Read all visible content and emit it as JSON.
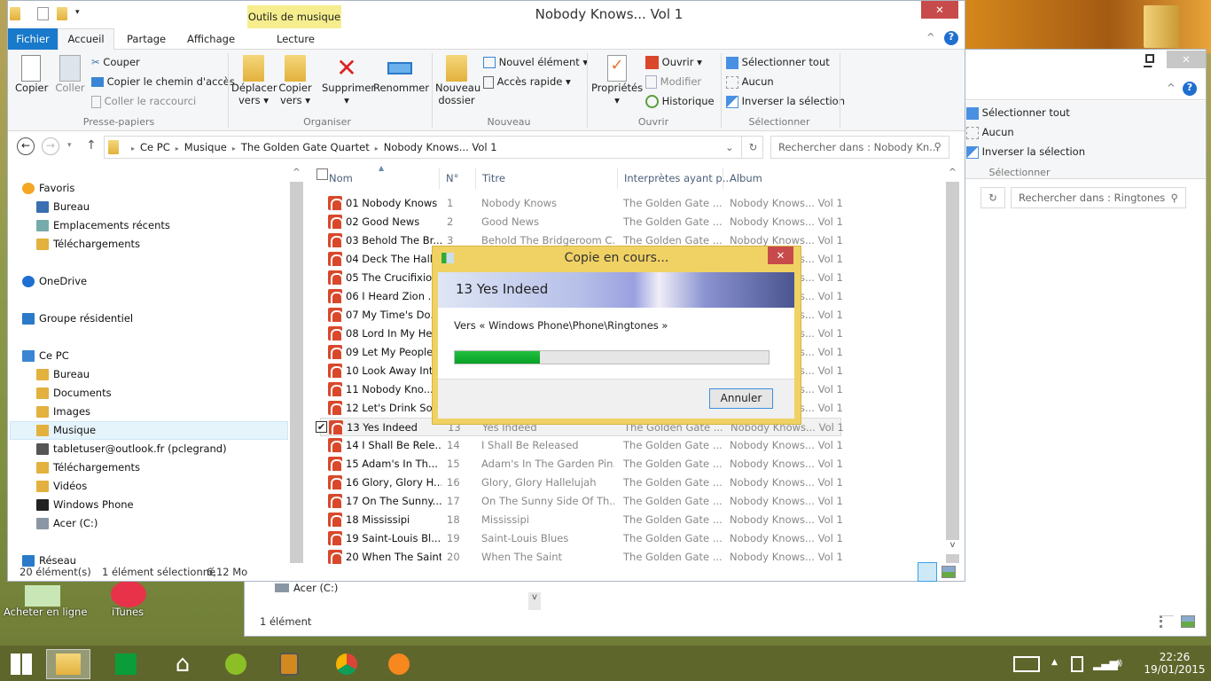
{
  "desktop": {
    "icons": [
      {
        "label": "Acheter en ligne"
      },
      {
        "label": "iTunes"
      }
    ]
  },
  "explorer": {
    "title": "Nobody Knows... Vol 1",
    "context_tab": "Outils de musique",
    "tabs": [
      "Fichier",
      "Accueil",
      "Partage",
      "Affichage",
      "Lecture"
    ],
    "ribbon": {
      "presse_papiers": {
        "label": "Presse-papiers",
        "copier": "Copier",
        "coller": "Coller",
        "couper": "Couper",
        "copier_chemin": "Copier le chemin d'accès",
        "coller_raccourci": "Coller le raccourci"
      },
      "organiser": {
        "label": "Organiser",
        "deplacer": "Déplacer",
        "vers": "vers",
        "copier": "Copier",
        "supprimer": "Supprimer",
        "renommer": "Renommer"
      },
      "nouveau": {
        "label": "Nouveau",
        "dossier1": "Nouveau",
        "dossier2": "dossier",
        "element": "Nouvel élément",
        "acces": "Accès rapide"
      },
      "ouvrir": {
        "label": "Ouvrir",
        "proprietes": "Propriétés",
        "ouvrir": "Ouvrir",
        "modifier": "Modifier",
        "historique": "Historique"
      },
      "selectionner": {
        "label": "Sélectionner",
        "tout": "Sélectionner tout",
        "aucun": "Aucun",
        "inverser": "Inverser la sélection"
      }
    },
    "breadcrumb": [
      "Ce PC",
      "Musique",
      "The Golden Gate Quartet",
      "Nobody Knows... Vol 1"
    ],
    "search_placeholder": "Rechercher dans : Nobody Kn...",
    "nav": [
      {
        "label": "Favoris",
        "icon": "star-icon",
        "level": 0
      },
      {
        "label": "Bureau",
        "icon": "desktop-icon",
        "level": 1
      },
      {
        "label": "Emplacements récents",
        "icon": "recent-icon",
        "level": 1
      },
      {
        "label": "Téléchargements",
        "icon": "downloads-folder-icon",
        "level": 1
      },
      {
        "label": "OneDrive",
        "icon": "onedrive-icon",
        "level": 0
      },
      {
        "label": "Groupe résidentiel",
        "icon": "homegroup-icon",
        "level": 0
      },
      {
        "label": "Ce PC",
        "icon": "computer-icon",
        "level": 0
      },
      {
        "label": "Bureau",
        "icon": "folder-icon",
        "level": 1
      },
      {
        "label": "Documents",
        "icon": "folder-icon",
        "level": 1
      },
      {
        "label": "Images",
        "icon": "folder-icon",
        "level": 1
      },
      {
        "label": "Musique",
        "icon": "folder-icon",
        "level": 1,
        "selected": true
      },
      {
        "label": "tabletuser@outlook.fr (pclegrand)",
        "icon": "user-icon",
        "level": 1
      },
      {
        "label": "Téléchargements",
        "icon": "folder-icon",
        "level": 1
      },
      {
        "label": "Vidéos",
        "icon": "folder-icon",
        "level": 1
      },
      {
        "label": "Windows Phone",
        "icon": "phone-icon",
        "level": 1
      },
      {
        "label": "Acer (C:)",
        "icon": "drive-icon",
        "level": 1
      },
      {
        "label": "Réseau",
        "icon": "network-icon",
        "level": 0
      }
    ],
    "columns": [
      "Nom",
      "N°",
      "Titre",
      "Interprètes ayant p...",
      "Album"
    ],
    "files": [
      {
        "name": "01 Nobody Knows",
        "n": "1",
        "title": "Nobody Knows",
        "artist": "The Golden Gate ...",
        "album": "Nobody Knows... Vol 1"
      },
      {
        "name": "02 Good News",
        "n": "2",
        "title": "Good News",
        "artist": "The Golden Gate ...",
        "album": "Nobody Knows... Vol 1"
      },
      {
        "name": "03 Behold The Br...",
        "n": "3",
        "title": "Behold The Bridgeroom C...",
        "artist": "The Golden Gate ...",
        "album": "Nobody Knows... Vol 1"
      },
      {
        "name": "04 Deck The Halls",
        "n": "",
        "title": "",
        "artist": "",
        "album": "Nobody Knows... Vol 1"
      },
      {
        "name": "05 The Crucifixion",
        "n": "",
        "title": "",
        "artist": "",
        "album": "Nobody Knows... Vol 1"
      },
      {
        "name": "06 I Heard Zion ...",
        "n": "",
        "title": "",
        "artist": "",
        "album": "Nobody Knows... Vol 1"
      },
      {
        "name": "07 My Time's Do...",
        "n": "",
        "title": "",
        "artist": "",
        "album": "Nobody Knows... Vol 1"
      },
      {
        "name": "08 Lord In My He...",
        "n": "",
        "title": "",
        "artist": "",
        "album": "Nobody Knows... Vol 1"
      },
      {
        "name": "09 Let My People",
        "n": "",
        "title": "",
        "artist": "",
        "album": "Nobody Knows... Vol 1"
      },
      {
        "name": "10 Look Away Int...",
        "n": "",
        "title": "",
        "artist": "",
        "album": "Nobody Knows... Vol 1"
      },
      {
        "name": "11 Nobody Kno...",
        "n": "",
        "title": "",
        "artist": "",
        "album": "Nobody Knows... Vol 1"
      },
      {
        "name": "12 Let's Drink So...",
        "n": "",
        "title": "",
        "artist": "",
        "album": "Nobody Knows... Vol 1"
      },
      {
        "name": "13 Yes Indeed",
        "n": "13",
        "title": "Yes Indeed",
        "artist": "The Golden Gate ...",
        "album": "Nobody Knows... Vol 1",
        "selected": true
      },
      {
        "name": "14 I Shall Be Rele...",
        "n": "14",
        "title": "I Shall Be Released",
        "artist": "The Golden Gate ...",
        "album": "Nobody Knows... Vol 1"
      },
      {
        "name": "15 Adam's In Th...",
        "n": "15",
        "title": "Adam's In The Garden Pin...",
        "artist": "The Golden Gate ...",
        "album": "Nobody Knows... Vol 1"
      },
      {
        "name": "16 Glory, Glory H...",
        "n": "16",
        "title": "Glory, Glory Hallelujah",
        "artist": "The Golden Gate ...",
        "album": "Nobody Knows... Vol 1"
      },
      {
        "name": "17 On The Sunny...",
        "n": "17",
        "title": "On The Sunny Side Of Th...",
        "artist": "The Golden Gate ...",
        "album": "Nobody Knows... Vol 1"
      },
      {
        "name": "18 Mississipi",
        "n": "18",
        "title": "Mississipi",
        "artist": "The Golden Gate ...",
        "album": "Nobody Knows... Vol 1"
      },
      {
        "name": "19 Saint-Louis Bl...",
        "n": "19",
        "title": "Saint-Louis Blues",
        "artist": "The Golden Gate ...",
        "album": "Nobody Knows... Vol 1"
      },
      {
        "name": "20 When The Saint",
        "n": "20",
        "title": "When The Saint",
        "artist": "The Golden Gate ...",
        "album": "Nobody Knows... Vol 1"
      }
    ],
    "status": {
      "count": "20 élément(s)",
      "selection": "1 élément sélectionné",
      "size": "6,12 Mo"
    }
  },
  "back_window": {
    "select_all": "Sélectionner tout",
    "none": "Aucun",
    "invert": "Inverser la sélection",
    "group": "Sélectionner",
    "search_placeholder": "Rechercher dans : Ringtones",
    "drive": "Acer (C:)",
    "status": "1 élément"
  },
  "dialog": {
    "title": "Copie en cours...",
    "file": "13 Yes Indeed",
    "destination": "Vers « Windows Phone\\Phone\\Ringtones »",
    "progress_percent": 27,
    "cancel": "Annuler",
    "accent": "#06b025"
  },
  "taskbar": {
    "apps": [
      "start-icon",
      "file-explorer-icon",
      "store-icon",
      "home-icon",
      "spotify-icon",
      "notes-icon",
      "chrome-icon",
      "avast-icon"
    ],
    "time": "22:26",
    "date": "19/01/2015"
  }
}
